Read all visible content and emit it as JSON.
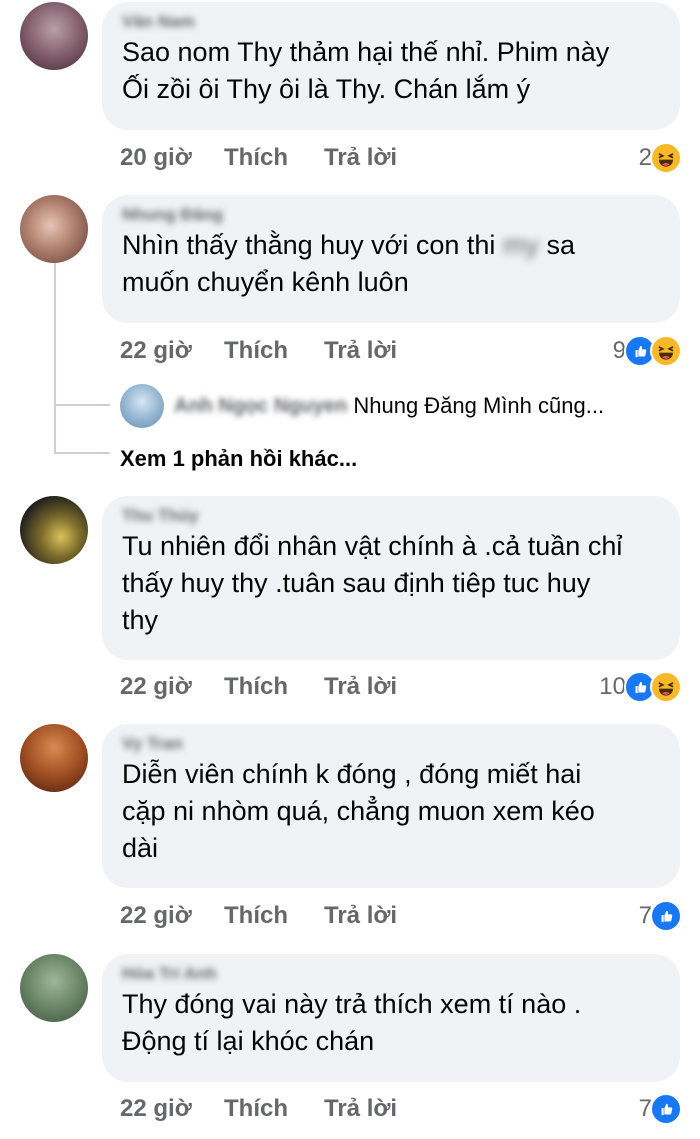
{
  "comments": [
    {
      "name": "Văn Nam",
      "text": "Sao nom Thy thảm hại thế nhỉ. Phim này\nỐi zồi ôi Thy ôi là Thy. Chán lắm ý",
      "time": "20 giờ",
      "like": "Thích",
      "reply": "Trả lời",
      "reaction_count": "2",
      "reactions": [
        "haha-icon"
      ]
    },
    {
      "name": "Nhung Đăng",
      "text_before": "Nhìn thấy thằng huy với con thi",
      "text_blur": "my",
      "text_after": " sa\nmuốn chuyển kênh luôn",
      "time": "22 giờ",
      "like": "Thích",
      "reply": "Trả lời",
      "reaction_count": "9",
      "reactions": [
        "like-icon",
        "haha-icon"
      ],
      "reply_preview": {
        "name": "Anh Ngọc Nguyen",
        "text": "Nhung Đăng Mình cũng..."
      },
      "more_replies": "Xem 1 phản hồi khác..."
    },
    {
      "name": "Thu Thúy",
      "text": "Tu nhiên đổi nhân vật chính à .cả tuần chỉ\nthấy huy thy .tuân sau định tiêp tuc huy\nthy",
      "time": "22 giờ",
      "like": "Thích",
      "reply": "Trả lời",
      "reaction_count": "10",
      "reactions": [
        "like-icon",
        "haha-icon"
      ]
    },
    {
      "name": "Vy Tran",
      "text": "Diễn viên chính k đóng , đóng miết hai\ncặp ni nhòm quá, chẳng muon xem kéo\ndài",
      "time": "22 giờ",
      "like": "Thích",
      "reply": "Trả lời",
      "reaction_count": "7",
      "reactions": [
        "like-icon"
      ]
    },
    {
      "name": "Hòa Trí Anh",
      "text": "Thy đóng vai này trả thích xem tí nào .\nĐộng tí lại khóc chán",
      "time": "22 giờ",
      "like": "Thích",
      "reply": "Trả lời",
      "reaction_count": "7",
      "reactions": [
        "like-icon"
      ]
    }
  ],
  "colors": {
    "bubble": "#f0f2f5",
    "meta_text": "#65676b",
    "like_blue": "#1877f2",
    "haha_yellow": "#f7b928"
  }
}
